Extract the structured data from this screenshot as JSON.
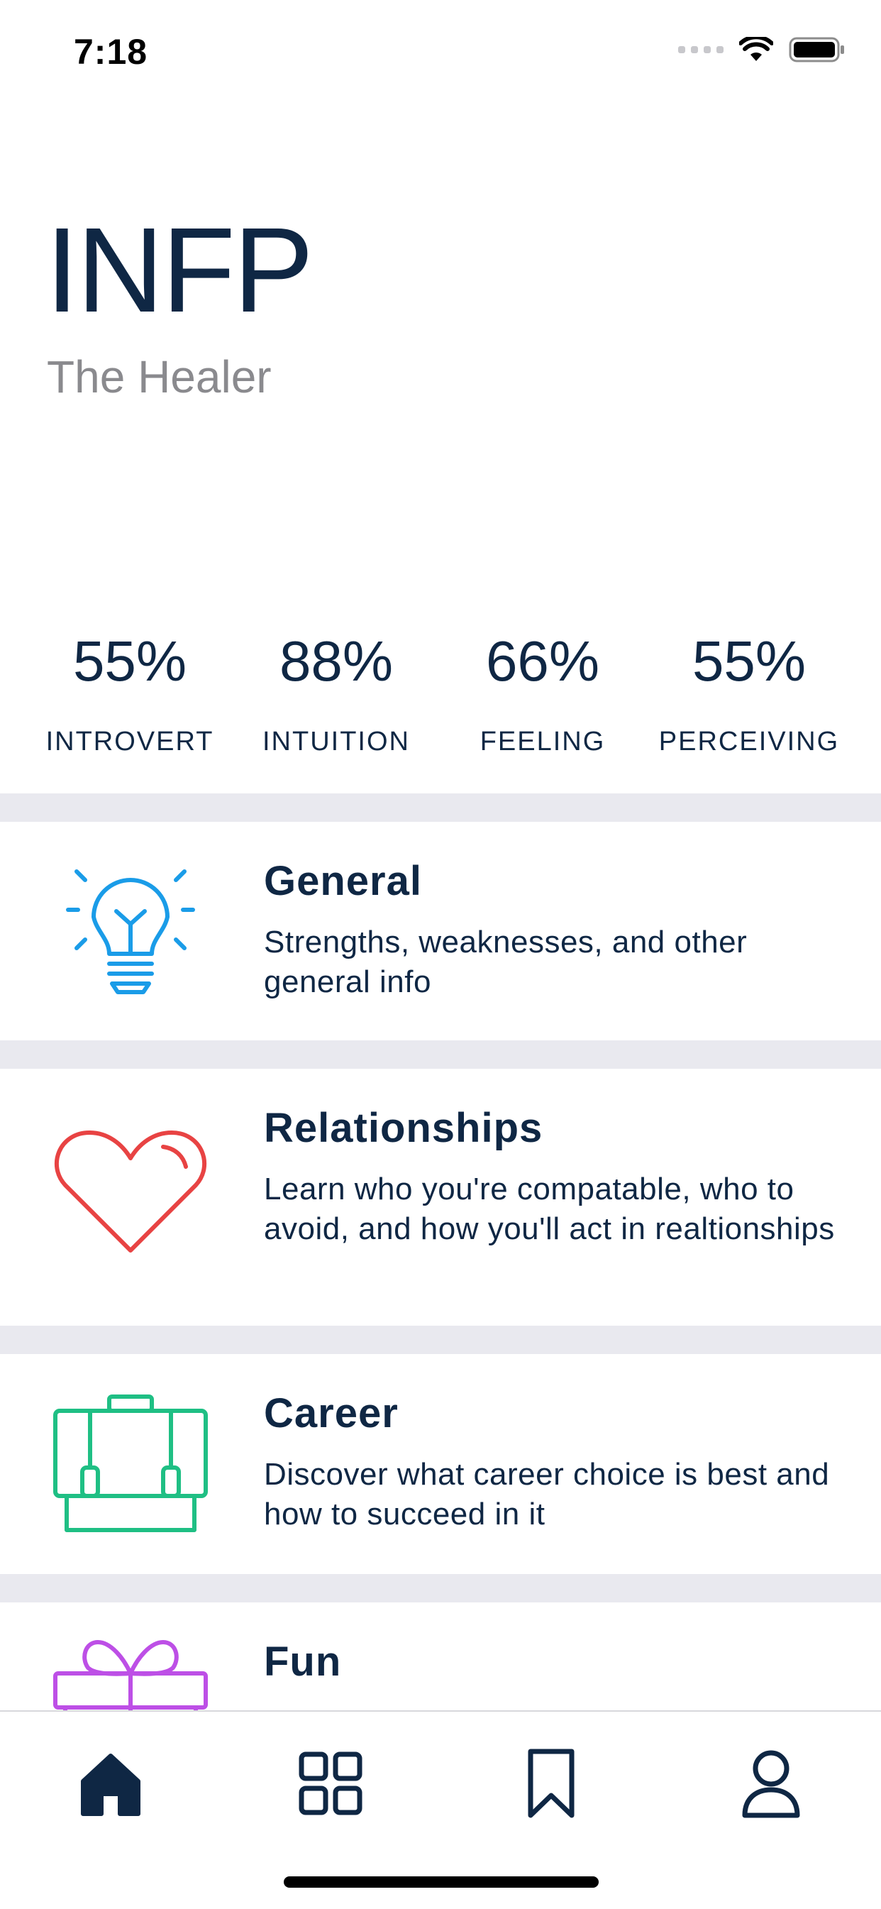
{
  "status_bar": {
    "time": "7:18",
    "icons": [
      "signal-icon",
      "wifi-icon",
      "battery-icon"
    ]
  },
  "profile": {
    "type_code": "INFP",
    "type_name": "The Healer"
  },
  "stats": [
    {
      "value": "55%",
      "label": "INTROVERT"
    },
    {
      "value": "88%",
      "label": "INTUITION"
    },
    {
      "value": "66%",
      "label": "FEELING"
    },
    {
      "value": "55%",
      "label": "PERCEIVING"
    }
  ],
  "categories": [
    {
      "title": "General",
      "description": "Strengths, weaknesses, and other general info",
      "icon": "lightbulb-icon",
      "color": "#1a9ce8"
    },
    {
      "title": "Relationships",
      "description": "Learn who you're compatable, who to avoid, and how you'll act in realtionships",
      "icon": "heart-icon",
      "color": "#e84343"
    },
    {
      "title": "Career",
      "description": "Discover what career choice is best and how to succeed in it",
      "icon": "briefcase-icon",
      "color": "#1fbf84"
    },
    {
      "title": "Fun",
      "description": "",
      "icon": "gift-icon",
      "color": "#bd4fe6"
    }
  ],
  "tab_bar": {
    "tabs": [
      "home-icon",
      "grid-icon",
      "bookmark-icon",
      "profile-icon"
    ],
    "active": "home-icon",
    "color": "#0f2744"
  }
}
